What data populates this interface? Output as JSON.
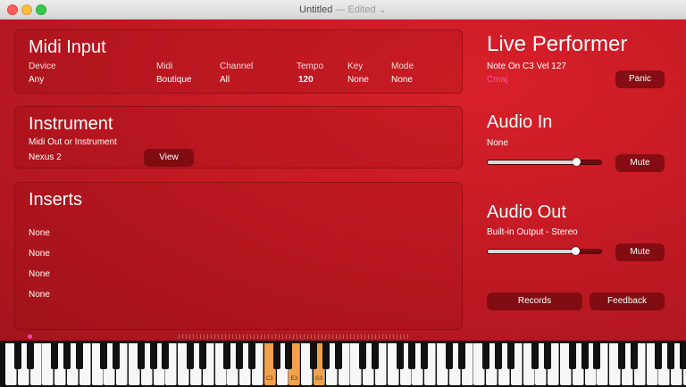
{
  "window": {
    "title": "Untitled",
    "edited_suffix": "— Edited ⌄"
  },
  "midi_input": {
    "title": "Midi Input",
    "columns": [
      {
        "label": "Device",
        "value": "Any"
      },
      {
        "label": "Midi",
        "value": "Boutique"
      },
      {
        "label": "Channel",
        "value": "All"
      },
      {
        "label": "Tempo",
        "value": "120"
      },
      {
        "label": "Key",
        "value": "None"
      },
      {
        "label": "Mode",
        "value": "None"
      }
    ]
  },
  "instrument": {
    "title": "Instrument",
    "subtitle": "Midi Out or Instrument",
    "value": "Nexus 2",
    "view_button": "View"
  },
  "inserts": {
    "title": "Inserts",
    "slots": [
      "None",
      "None",
      "None",
      "None"
    ]
  },
  "live_performer": {
    "title": "Live Performer",
    "note_status": "Note On C3 Vel 127",
    "chord": "Cmaj",
    "chord_color": "#ff4fb5",
    "panic_button": "Panic"
  },
  "audio_in": {
    "title": "Audio In",
    "source": "None",
    "level": 0.78,
    "mute_button": "Mute"
  },
  "audio_out": {
    "title": "Audio Out",
    "device": "Built-in Output - Stereo",
    "level": 0.77,
    "mute_button": "Mute"
  },
  "footer": {
    "records_button": "Records",
    "feedback_button": "Feedback"
  },
  "keyboard": {
    "white_key_count": 56,
    "pressed_notes": [
      {
        "index": 21,
        "label": "C3"
      },
      {
        "index": 23,
        "label": "E3"
      },
      {
        "index": 25,
        "label": "G3"
      }
    ],
    "pressed_color": "#f2a24c"
  },
  "colors": {
    "background": "#c41a24",
    "button": "#6e080e"
  }
}
